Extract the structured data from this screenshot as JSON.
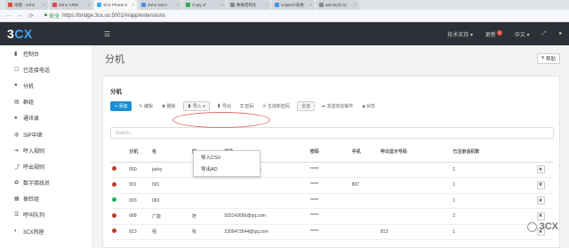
{
  "browser": {
    "tabs": [
      {
        "label": "地图 - Zoho",
        "color": "#e04b3a",
        "active": false
      },
      {
        "label": "Zoho CRM",
        "color": "#e04b3a",
        "active": false
      },
      {
        "label": "3CX Phone S",
        "color": "#3fa9f5",
        "active": true
      },
      {
        "label": "Zoho Docs",
        "color": "#4a90e2",
        "active": false
      },
      {
        "label": "Copy of",
        "color": "#34a853",
        "active": false
      },
      {
        "label": "数据结构比",
        "color": "#888888",
        "active": false
      },
      {
        "label": "voiptech表格",
        "color": "#4a90e2",
        "active": false
      },
      {
        "label": "admin(3CX)",
        "color": "#888888",
        "active": false
      }
    ],
    "secure_label": "安全",
    "url": "https://bridge.3cx.us:5001/#/app/extensions"
  },
  "app": {
    "logo": {
      "prefix": "3",
      "suffix": "CX"
    },
    "top_right": {
      "support": "技术支持 ▾",
      "updates": "更新",
      "updates_count": "3",
      "language": "中文 ▾"
    }
  },
  "sidebar": {
    "items": [
      {
        "label": "控制台",
        "icon": "dashboard-icon",
        "glyph": "▮"
      },
      {
        "label": "已连接电话",
        "icon": "phone-icon",
        "glyph": "☐"
      },
      {
        "label": "分机",
        "icon": "user-icon",
        "glyph": "●"
      },
      {
        "label": "群组",
        "icon": "group-icon",
        "glyph": "▤"
      },
      {
        "label": "通讯录",
        "icon": "contacts-icon",
        "glyph": "●"
      },
      {
        "label": "SIP中继",
        "icon": "globe-icon",
        "glyph": "◍"
      },
      {
        "label": "呼入规则",
        "icon": "inbound-icon",
        "glyph": "➔"
      },
      {
        "label": "呼出规则",
        "icon": "outbound-icon",
        "glyph": "⤴"
      },
      {
        "label": "数字接线员",
        "icon": "attendant-icon",
        "glyph": "✿"
      },
      {
        "label": "振铃组",
        "icon": "ring-group-icon",
        "glyph": "▦"
      },
      {
        "label": "呼叫队列",
        "icon": "queue-icon",
        "glyph": "☰"
      },
      {
        "label": "3CX热座",
        "icon": "hotdesk-icon",
        "glyph": "◐"
      }
    ]
  },
  "page": {
    "title": "分机",
    "help": "帮助",
    "panel_title": "分机"
  },
  "toolbar": {
    "add": "+ 添加",
    "edit": "✎ 编辑",
    "delete": "✖ 删除",
    "import": "⬇ 导入 ▾",
    "export": "⬆ 导出",
    "password": "⚿ 密码",
    "regenerate": "⟳ 生成新密码",
    "select_all": "全选",
    "send_welcome": "➦ 发送欢迎邮件",
    "status": "■ 状态"
  },
  "import_menu": {
    "csv": "导入CSV",
    "ad": "导出AD"
  },
  "search": {
    "placeholder": "Search..."
  },
  "table": {
    "headers": [
      "",
      "分机",
      "名",
      "姓",
      "邮件",
      "密码",
      "手机",
      "呼出显示号码",
      "已注册话机数",
      ""
    ],
    "rows": [
      {
        "status": "#c0392b",
        "ext": "000",
        "first": "jacky",
        "last": "",
        "email": "joe@voiptech.com",
        "pwd": "*****",
        "mobile": "",
        "outcid": "",
        "registered": "1"
      },
      {
        "status": "#c0392b",
        "ext": "001",
        "first": "001",
        "last": "",
        "email": "",
        "pwd": "*****",
        "mobile": "807",
        "outcid": "",
        "registered": "1"
      },
      {
        "status": "#27ae60",
        "ext": "003",
        "first": "003",
        "last": "",
        "email": "",
        "pwd": "*****",
        "mobile": "",
        "outcid": "",
        "registered": "1"
      },
      {
        "status": "#c0392b",
        "ext": "668",
        "first": "广能",
        "last": "符",
        "email": "925142686@qq.com",
        "pwd": "*****",
        "mobile": "",
        "outcid": "",
        "registered": "2"
      },
      {
        "status": "#c0392b",
        "ext": "813",
        "first": "强",
        "last": "张",
        "email": "2309473544@qq.com",
        "pwd": "*****",
        "mobile": "",
        "outcid": "813",
        "registered": "1"
      }
    ]
  },
  "watermark": "3CX"
}
